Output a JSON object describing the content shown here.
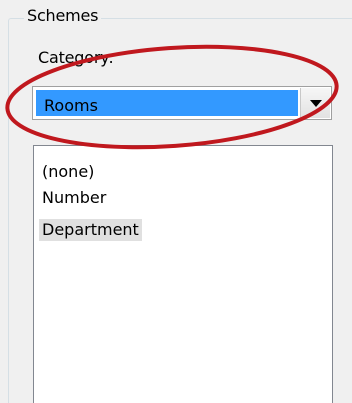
{
  "groupbox": {
    "title": "Schemes"
  },
  "category": {
    "label": "Category:",
    "selected_value": "Rooms"
  },
  "list": {
    "items": [
      "(none)",
      "Number",
      "Department"
    ]
  },
  "colors": {
    "annotation": "#c0181e",
    "selection": "#3399ff",
    "item_highlight": "#e0e0e0"
  },
  "icons": {
    "dropdown": "chevron-down-icon"
  }
}
